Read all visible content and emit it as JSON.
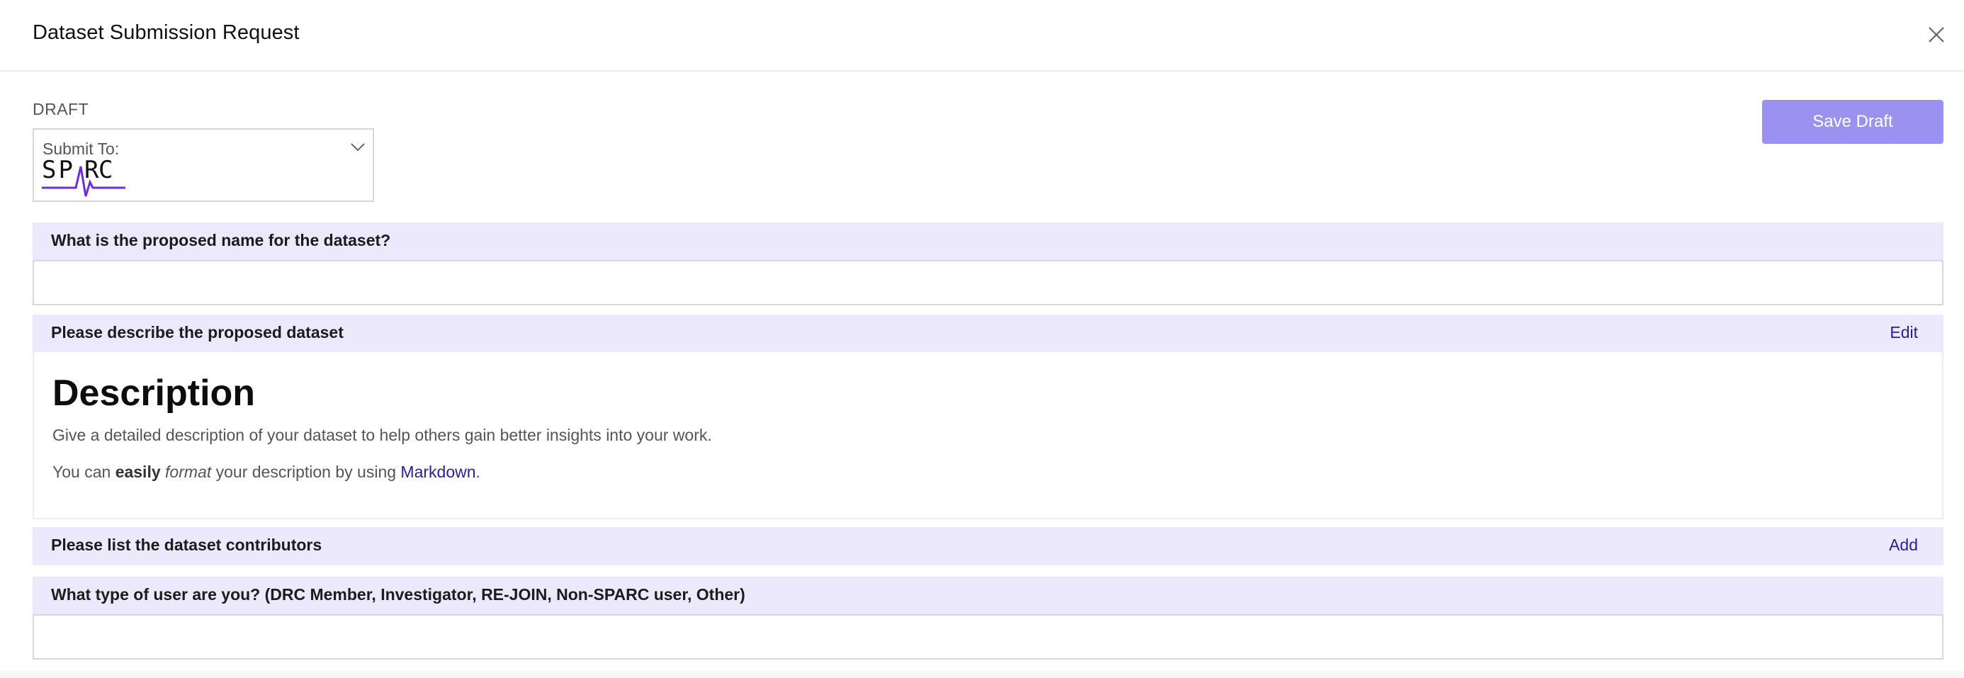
{
  "modal": {
    "title": "Dataset Submission Request"
  },
  "form": {
    "status": "DRAFT",
    "save_label": "Save Draft",
    "submit_to": {
      "label": "Submit To:",
      "selected_logo_text": "SPARC"
    },
    "sections": {
      "name": {
        "question": "What is the proposed name for the dataset?",
        "value": "",
        "placeholder": ""
      },
      "description": {
        "question": "Please describe the proposed dataset",
        "action": "Edit",
        "heading": "Description",
        "para1": "Give a detailed description of your dataset to help others gain better insights into your work.",
        "para2_prefix": "You can ",
        "para2_bold": "easily",
        "para2_italic": "format",
        "para2_middle": " your description by using ",
        "para2_link": "Markdown",
        "para2_suffix": "."
      },
      "contributors": {
        "question": "Please list the dataset contributors",
        "action": "Add"
      },
      "user_type": {
        "question": "What type of user are you? (DRC Member, Investigator, RE-JOIN, Non-SPARC user, Other)",
        "value": "",
        "placeholder": ""
      }
    }
  },
  "colors": {
    "accent": "#9b91f1",
    "section_bg": "#ebe9fb",
    "link": "#2a1e9a",
    "logo_purple": "#6b2fd6"
  },
  "icons": {
    "close": "close-icon",
    "dropdown": "chevron-down-icon"
  }
}
